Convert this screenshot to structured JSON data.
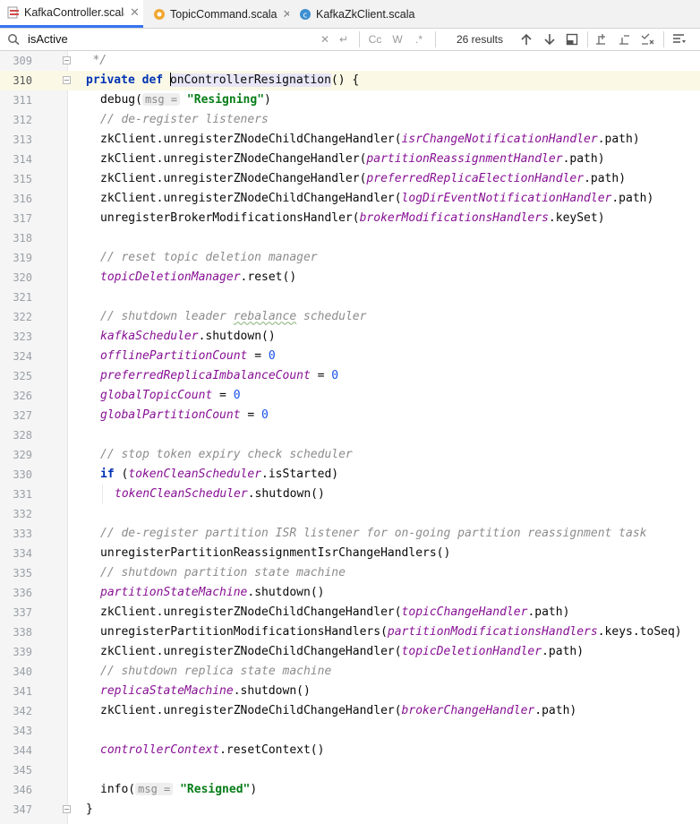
{
  "tabs": [
    {
      "label": "KafkaController.scala",
      "active": true,
      "icon": "scala-file-icon"
    },
    {
      "label": "TopicCommand.scala",
      "active": false,
      "icon": "scala-object-icon"
    },
    {
      "label": "KafkaZkClient.scala",
      "active": false,
      "icon": "scala-class-icon"
    }
  ],
  "search": {
    "query": "isActive",
    "results": "26 results",
    "match_case": "Cc",
    "words": "W",
    "regex": ".*"
  },
  "lines": [
    {
      "n": "309",
      "code": "   */"
    },
    {
      "n": "310",
      "code": "private def onControllerResignation() {"
    },
    {
      "n": "311",
      "code": "debug(",
      "hint": "msg =",
      "str": "\"Resigning\""
    },
    {
      "n": "312",
      "code": "// de-register listeners"
    },
    {
      "n": "313",
      "pre": "zkClient.unregisterZNodeChildChangeHandler(",
      "fld": "isrChangeNotificationHandler",
      "post": ".path)"
    },
    {
      "n": "314",
      "pre": "zkClient.unregisterZNodeChangeHandler(",
      "fld": "partitionReassignmentHandler",
      "post": ".path)"
    },
    {
      "n": "315",
      "pre": "zkClient.unregisterZNodeChangeHandler(",
      "fld": "preferredReplicaElectionHandler",
      "post": ".path)"
    },
    {
      "n": "316",
      "pre": "zkClient.unregisterZNodeChildChangeHandler(",
      "fld": "logDirEventNotificationHandler",
      "post": ".path)"
    },
    {
      "n": "317",
      "pre": "unregisterBrokerModificationsHandler(",
      "fld": "brokerModificationsHandlers",
      "post": ".keySet)"
    },
    {
      "n": "318",
      "code": ""
    },
    {
      "n": "319",
      "code": "// reset topic deletion manager"
    },
    {
      "n": "320",
      "fld": "topicDeletionManager",
      "post": ".reset()"
    },
    {
      "n": "321",
      "code": ""
    },
    {
      "n": "322",
      "cmt_pre": "// shutdown leader ",
      "cmt_sq": "rebalance",
      "cmt_post": " scheduler"
    },
    {
      "n": "323",
      "fld": "kafkaScheduler",
      "post": ".shutdown()"
    },
    {
      "n": "324",
      "fld": "offlinePartitionCount",
      "post": " = ",
      "num": "0"
    },
    {
      "n": "325",
      "fld": "preferredReplicaImbalanceCount",
      "post": " = ",
      "num": "0"
    },
    {
      "n": "326",
      "fld": "globalTopicCount",
      "post": " = ",
      "num": "0"
    },
    {
      "n": "327",
      "fld": "globalPartitionCount",
      "post": " = ",
      "num": "0"
    },
    {
      "n": "328",
      "code": ""
    },
    {
      "n": "329",
      "code": "// stop token expiry check scheduler"
    },
    {
      "n": "330",
      "kw": "if",
      "pre": " (",
      "fld": "tokenCleanScheduler",
      "post": ".isStarted)"
    },
    {
      "n": "331",
      "fld": "tokenCleanScheduler",
      "post": ".shutdown()"
    },
    {
      "n": "332",
      "code": ""
    },
    {
      "n": "333",
      "code": "// de-register partition ISR listener for on-going partition reassignment task"
    },
    {
      "n": "334",
      "code": "unregisterPartitionReassignmentIsrChangeHandlers()"
    },
    {
      "n": "335",
      "code": "// shutdown partition state machine"
    },
    {
      "n": "336",
      "fld": "partitionStateMachine",
      "post": ".shutdown()"
    },
    {
      "n": "337",
      "pre": "zkClient.unregisterZNodeChildChangeHandler(",
      "fld": "topicChangeHandler",
      "post": ".path)"
    },
    {
      "n": "338",
      "pre": "unregisterPartitionModificationsHandlers(",
      "fld": "partitionModificationsHandlers",
      "post": ".keys.toSeq)"
    },
    {
      "n": "339",
      "pre": "zkClient.unregisterZNodeChildChangeHandler(",
      "fld": "topicDeletionHandler",
      "post": ".path)"
    },
    {
      "n": "340",
      "code": "// shutdown replica state machine"
    },
    {
      "n": "341",
      "fld": "replicaStateMachine",
      "post": ".shutdown()"
    },
    {
      "n": "342",
      "pre": "zkClient.unregisterZNodeChildChangeHandler(",
      "fld": "brokerChangeHandler",
      "post": ".path)"
    },
    {
      "n": "343",
      "code": ""
    },
    {
      "n": "344",
      "fld": "controllerContext",
      "post": ".resetContext()"
    },
    {
      "n": "345",
      "code": ""
    },
    {
      "n": "346",
      "code": "info(",
      "hint": "msg =",
      "str": "\"Resigned\""
    },
    {
      "n": "347",
      "code": "}"
    }
  ]
}
